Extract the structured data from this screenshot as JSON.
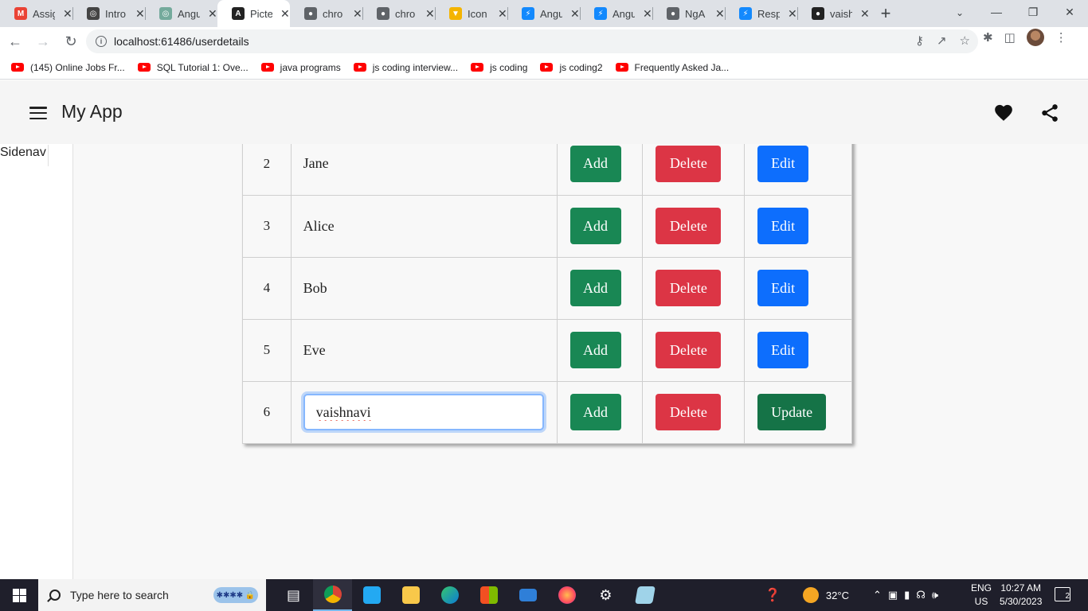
{
  "browser": {
    "tabs": [
      {
        "title": "Assig",
        "icon": "gmail-icon",
        "color": "#ea4335",
        "glyph": "M"
      },
      {
        "title": "Intro",
        "icon": "openai-icon",
        "color": "#444444",
        "glyph": "◎"
      },
      {
        "title": "Angu",
        "icon": "chatgpt-icon",
        "color": "#74aa9c",
        "glyph": "◎"
      },
      {
        "title": "Picte",
        "icon": "angular-icon",
        "color": "#222222",
        "glyph": "A"
      },
      {
        "title": "chro",
        "icon": "globe-icon",
        "color": "#5f6368",
        "glyph": "●"
      },
      {
        "title": "chro",
        "icon": "globe-icon",
        "color": "#5f6368",
        "glyph": "●"
      },
      {
        "title": "Icon",
        "icon": "shield-icon",
        "color": "#f4b400",
        "glyph": "▼"
      },
      {
        "title": "Angu",
        "icon": "stackblitz-icon",
        "color": "#1389fd",
        "glyph": "⚡"
      },
      {
        "title": "Angu",
        "icon": "stackblitz-icon",
        "color": "#1389fd",
        "glyph": "⚡"
      },
      {
        "title": "NgA",
        "icon": "globe-icon",
        "color": "#5f6368",
        "glyph": "●"
      },
      {
        "title": "Resp",
        "icon": "stackblitz-icon",
        "color": "#1389fd",
        "glyph": "⚡"
      },
      {
        "title": "vaish",
        "icon": "github-icon",
        "color": "#222222",
        "glyph": "●"
      }
    ],
    "active_tab_index": 3,
    "url": "localhost:61486/userdetails",
    "bookmarks": [
      "(145) Online Jobs Fr...",
      "SQL Tutorial 1: Ove...",
      "java programs",
      "js coding interview...",
      "js coding",
      "js coding2",
      "Frequently Asked Ja..."
    ]
  },
  "app": {
    "title": "My App",
    "sidenav_label": "Sidenav"
  },
  "table": {
    "rows": [
      {
        "id": "2",
        "name": "Jane",
        "add": "Add",
        "delete": "Delete",
        "action": "Edit",
        "editing": false
      },
      {
        "id": "3",
        "name": "Alice",
        "add": "Add",
        "delete": "Delete",
        "action": "Edit",
        "editing": false
      },
      {
        "id": "4",
        "name": "Bob",
        "add": "Add",
        "delete": "Delete",
        "action": "Edit",
        "editing": false
      },
      {
        "id": "5",
        "name": "Eve",
        "add": "Add",
        "delete": "Delete",
        "action": "Edit",
        "editing": false
      },
      {
        "id": "6",
        "name": "vaishnavi",
        "add": "Add",
        "delete": "Delete",
        "action": "Update",
        "editing": true
      }
    ],
    "colors": {
      "add": "#198754",
      "delete": "#dc3545",
      "edit": "#0d6efd",
      "update": "#157347"
    }
  },
  "taskbar": {
    "search_placeholder": "Type here to search",
    "weather": "32°C",
    "lang_top": "ENG",
    "lang_bottom": "US",
    "time": "10:27 AM",
    "date": "5/30/2023",
    "notifications": "2"
  }
}
